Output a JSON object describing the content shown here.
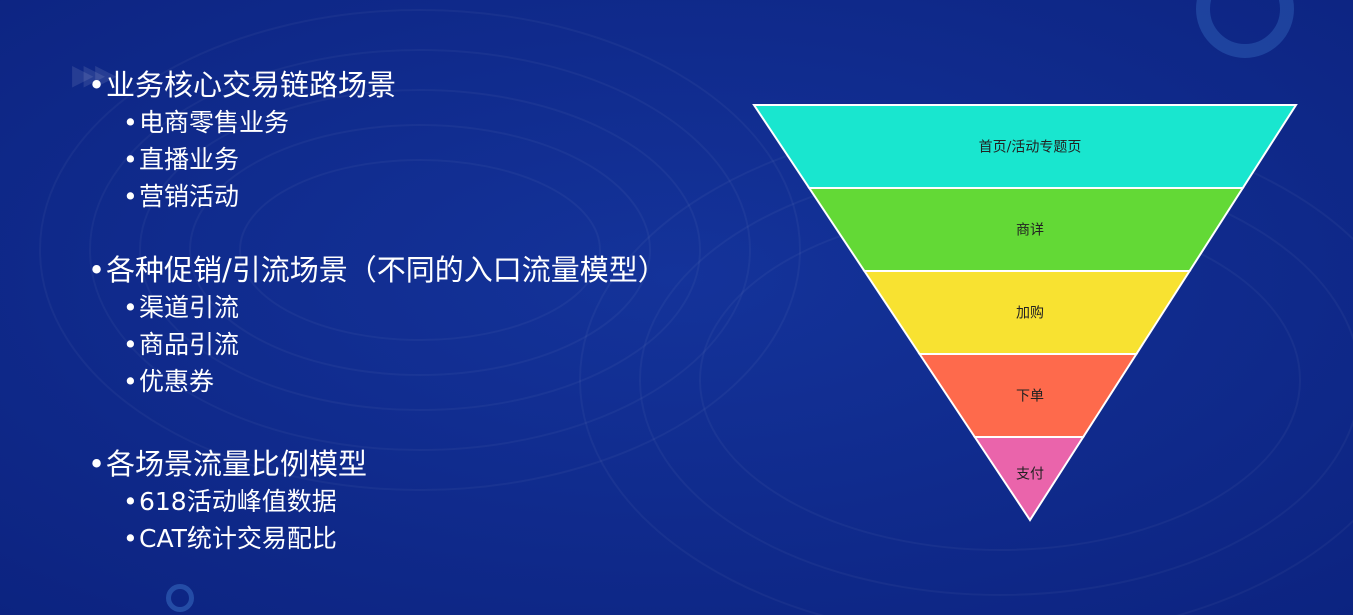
{
  "outline": [
    {
      "title": "业务核心交易链路场景",
      "items": [
        "电商零售业务",
        "直播业务",
        "营销活动"
      ]
    },
    {
      "title": "各种促销/引流场景（不同的入口流量模型）",
      "items": [
        "渠道引流",
        "商品引流",
        "优惠券"
      ]
    },
    {
      "title": "各场景流量比例模型",
      "items": [
        "618活动峰值数据",
        "CAT统计交易配比"
      ]
    }
  ],
  "bullet": "•",
  "funnel": {
    "stages": [
      {
        "label": "首页/活动专题页",
        "color": "#19e6cf"
      },
      {
        "label": "商详",
        "color": "#63d936"
      },
      {
        "label": "加购",
        "color": "#f8e231"
      },
      {
        "label": "下单",
        "color": "#fe6a4c"
      },
      {
        "label": "支付",
        "color": "#ea64ab"
      }
    ]
  },
  "colors": {
    "background": "#102a8c",
    "text": "#ffffff"
  }
}
